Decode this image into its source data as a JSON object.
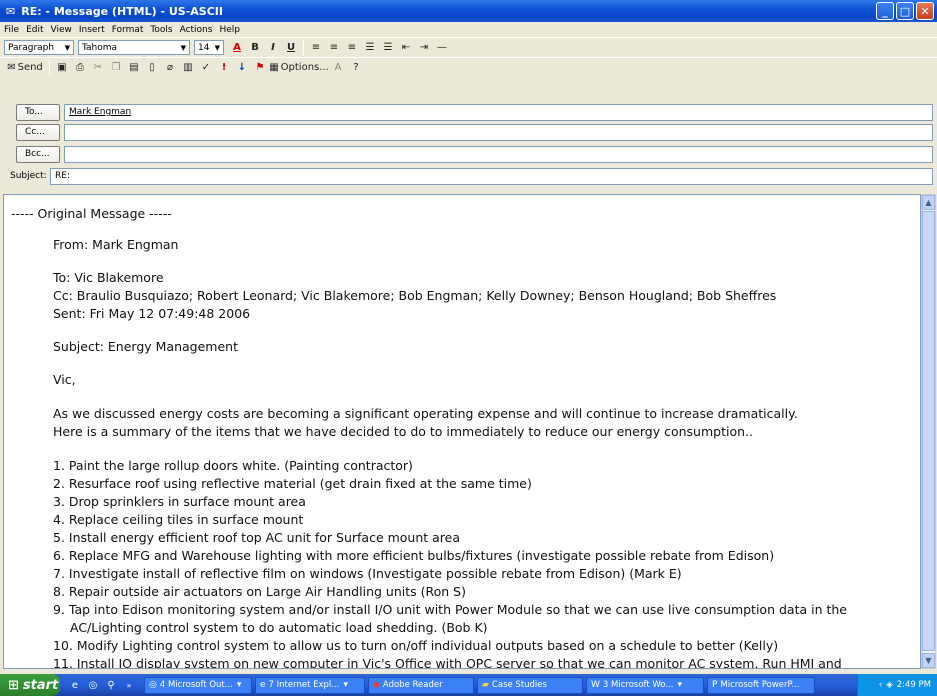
{
  "window": {
    "title": "RE: - Message (HTML) - US-ASCII",
    "buttons": {
      "minimize": "_",
      "maximize": "□",
      "close": "✕"
    }
  },
  "menu": [
    "File",
    "Edit",
    "View",
    "Insert",
    "Format",
    "Tools",
    "Actions",
    "Help"
  ],
  "format_toolbar": {
    "style": "Paragraph",
    "font": "Tahoma",
    "size": "14",
    "bold": "B",
    "italic": "I",
    "underline": "U"
  },
  "standard_toolbar": {
    "send": "Send",
    "options": "Options..."
  },
  "fields": {
    "to_label": "To...",
    "to_value": "Mark Engman",
    "cc_label": "Cc...",
    "cc_value": "",
    "bcc_label": "Bcc...",
    "bcc_value": "",
    "subject_label": "Subject:",
    "subject_value": "RE:"
  },
  "message": {
    "header": "----- Original Message -----",
    "from": "From: Mark Engman",
    "to": "To: Vic Blakemore",
    "cc": "Cc: Braulio Busquiazo; Robert Leonard; Vic Blakemore; Bob Engman; Kelly Downey; Benson Hougland; Bob Sheffres",
    "sent": "Sent: Fri May 12 07:49:48 2006",
    "subject": "Subject: Energy Management",
    "greeting": "Vic,",
    "para1": "As we discussed energy costs are becoming a significant operating expense and will continue to increase dramatically.",
    "para2": "Here is a summary of the items that we have decided to do to immediately to reduce our energy consumption..",
    "items": [
      "1. Paint the large rollup doors white. (Painting contractor)",
      "2. Resurface roof using reflective material (get drain fixed at the same time)",
      "3. Drop sprinklers in surface mount area",
      "4. Replace ceiling tiles in surface mount",
      "5. Install energy efficient roof top AC unit for Surface mount area",
      "6. Replace MFG and Warehouse lighting with more efficient bulbs/fixtures (investigate possible rebate from Edison)",
      "7. Investigate install of reflective film on windows (Investigate possible rebate from Edison) (Mark E)",
      "8. Repair outside air actuators on Large Air Handling units (Ron S)",
      "9. Tap into Edison monitoring system and/or install I/O unit with Power Module so that we can use live consumption data in the",
      "AC/Lighting control system to do automatic load shedding. (Bob K)",
      "10. Modify Lighting control system to allow us to turn on/off individual outputs based on a schedule to better (Kelly)",
      "11. Install IO display system on new computer in Vic's Office with OPC server so that we can monitor AC system. Run HMI and"
    ]
  },
  "taskbar": {
    "start": "start",
    "tasks": [
      "4 Microsoft Out...",
      "7 Internet Expl...",
      "Adobe Reader",
      "Case Studies",
      "3 Microsoft Wo...",
      "Microsoft PowerP..."
    ],
    "clock": "2:49 PM"
  }
}
